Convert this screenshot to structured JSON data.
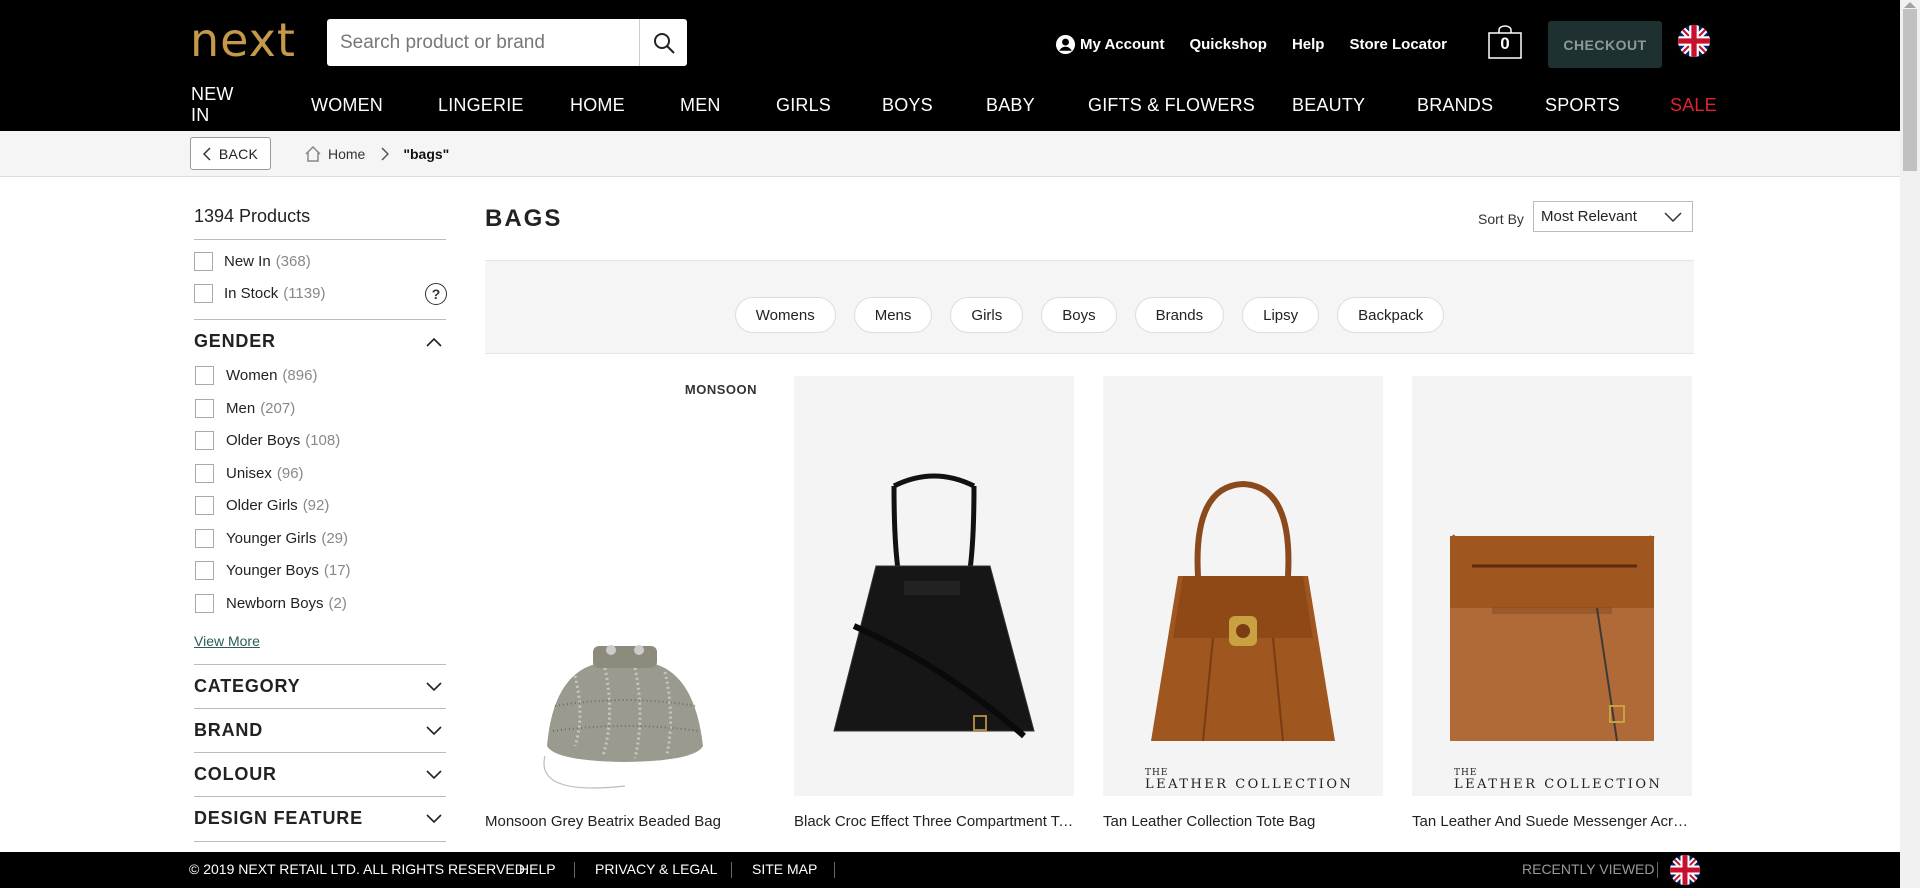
{
  "header": {
    "logo": "next",
    "search_placeholder": "Search product or brand",
    "links": [
      "My Account",
      "Quickshop",
      "Help",
      "Store Locator"
    ],
    "bag_count": "0",
    "checkout": "CHECKOUT",
    "nav": [
      "NEW IN",
      "WOMEN",
      "LINGERIE",
      "HOME",
      "MEN",
      "GIRLS",
      "BOYS",
      "BABY",
      "GIFTS & FLOWERS",
      "BEAUTY",
      "BRANDS",
      "SPORTS",
      "SALE"
    ],
    "sale_color": "#e0212e",
    "brand_color": "#c49a4a"
  },
  "breadcrumb": {
    "back": "BACK",
    "home": "Home",
    "current": "\"bags\""
  },
  "sidebar": {
    "product_count": "1394 Products",
    "quick_filters": [
      {
        "label": "New In",
        "count": "(368)"
      },
      {
        "label": "In Stock",
        "count": "(1139)"
      }
    ],
    "gender_title": "GENDER",
    "gender": [
      {
        "label": "Women",
        "count": "(896)"
      },
      {
        "label": "Men",
        "count": "(207)"
      },
      {
        "label": "Older Boys",
        "count": "(108)"
      },
      {
        "label": "Unisex",
        "count": "(96)"
      },
      {
        "label": "Older Girls",
        "count": "(92)"
      },
      {
        "label": "Younger Girls",
        "count": "(29)"
      },
      {
        "label": "Younger Boys",
        "count": "(17)"
      },
      {
        "label": "Newborn Boys",
        "count": "(2)"
      }
    ],
    "view_more": "View More",
    "sections": [
      "CATEGORY",
      "BRAND",
      "COLOUR",
      "DESIGN FEATURE"
    ]
  },
  "main": {
    "title": "BAGS",
    "sort_label": "Sort By",
    "sort_value": "Most Relevant",
    "chips": [
      "Womens",
      "Mens",
      "Girls",
      "Boys",
      "Brands",
      "Lipsy",
      "Backpack"
    ],
    "products": [
      {
        "name": "Monsoon Grey Beatrix Beaded Bag",
        "brand_tag": "MONSOON"
      },
      {
        "name": "Black Croc Effect Three Compartment Tote Bag"
      },
      {
        "name": "Tan Leather Collection Tote Bag",
        "collection_top": "THE",
        "collection": "LEATHER COLLECTION"
      },
      {
        "name": "Tan Leather And Suede Messenger Across-Body Bag",
        "collection_top": "THE",
        "collection": "LEATHER COLLECTION"
      }
    ]
  },
  "footer": {
    "copyright": "© 2019 NEXT RETAIL LTD. ALL RIGHTS RESERVED.",
    "links": [
      "HELP",
      "PRIVACY & LEGAL",
      "SITE MAP"
    ],
    "recently_viewed": "RECENTLY VIEWED"
  }
}
